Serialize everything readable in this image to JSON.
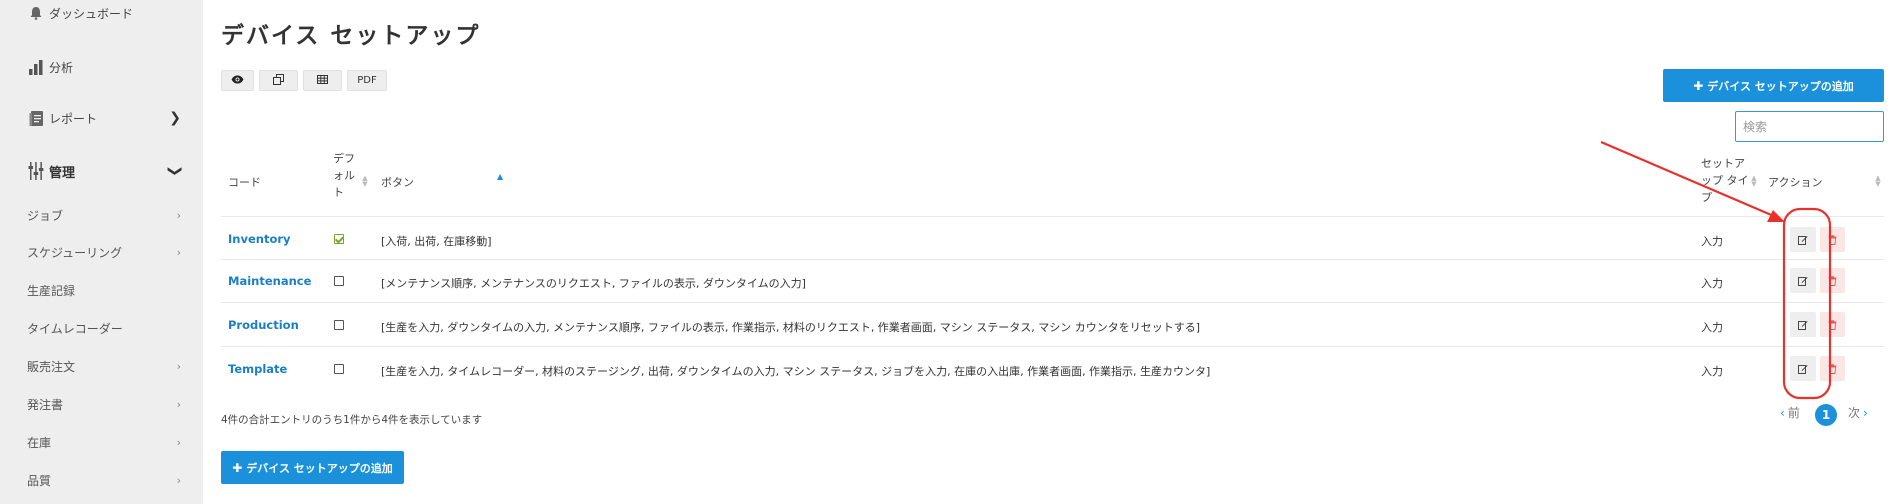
{
  "sidebar": {
    "items": [
      {
        "label": "ダッシュボード",
        "icon": "bell-icon"
      },
      {
        "label": "分析",
        "icon": "bar-chart-icon"
      },
      {
        "label": "レポート",
        "icon": "report-icon"
      },
      {
        "label": "管理",
        "icon": "manage-icon"
      },
      {
        "label": "ジョブ"
      },
      {
        "label": "スケジューリング"
      },
      {
        "label": "生産記録"
      },
      {
        "label": "タイムレコーダー"
      },
      {
        "label": "販売注文"
      },
      {
        "label": "発注書"
      },
      {
        "label": "在庫"
      },
      {
        "label": "品質"
      }
    ]
  },
  "page": {
    "title": "デバイス セットアップ"
  },
  "toolbar": {
    "view_icon": "eye-icon",
    "copy_icon": "copy-icon",
    "grid_icon": "table-icon",
    "pdf_label": "PDF"
  },
  "actions": {
    "add_label": "デバイス セットアップの追加",
    "add_icon": "plus-icon"
  },
  "search": {
    "placeholder": "検索"
  },
  "table": {
    "headers": {
      "code": "コード",
      "default_1": "デフ",
      "default_2": "ォル",
      "default_3": "ト",
      "buttons": "ボタン",
      "type_1": "セットア",
      "type_2": "ップ タイ",
      "type_3": "プ",
      "action": "アクション"
    },
    "rows": [
      {
        "code": "Inventory",
        "default": true,
        "buttons": "[入荷, 出荷, 在庫移動]",
        "type": "入力"
      },
      {
        "code": "Maintenance",
        "default": false,
        "buttons": "[メンテナンス順序, メンテナンスのリクエスト, ファイルの表示, ダウンタイムの入力]",
        "type": "入力"
      },
      {
        "code": "Production",
        "default": false,
        "buttons": "[生産を入力, ダウンタイムの入力, メンテナンス順序, ファイルの表示, 作業指示, 材料のリクエスト, 作業者画面, マシン ステータス, マシン カウンタをリセットする]",
        "type": "入力"
      },
      {
        "code": "Template",
        "default": false,
        "buttons": "[生産を入力, タイムレコーダー, 材料のステージング, 出荷, ダウンタイムの入力, マシン ステータス, ジョブを入力, 在庫の入出庫, 作業者画面, 作業指示, 生産カウンタ]",
        "type": "入力"
      }
    ],
    "edit_icon": "edit-icon",
    "delete_icon": "trash-icon"
  },
  "footer": {
    "info": "4件の合計エントリのうち1件から4件を表示しています",
    "prev": "前",
    "page": "1",
    "next": "次"
  },
  "annotation": {
    "color": "#e8312a"
  }
}
